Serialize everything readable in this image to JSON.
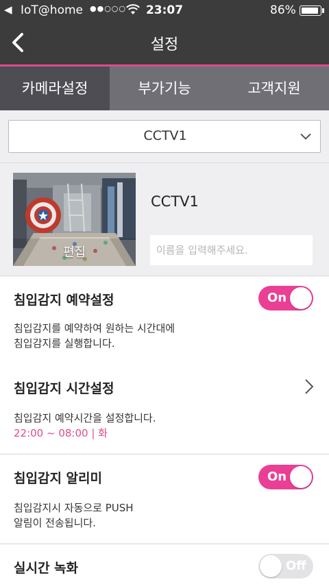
{
  "status_bar": {
    "back_app": "◀",
    "carrier": "IoT@home",
    "signal": "●●○○○",
    "time": "23:07",
    "battery_percent": "86%",
    "battery_level": 0.86
  },
  "header": {
    "title": "설정",
    "back_icon": "chevron-left-icon"
  },
  "tabs": [
    {
      "label": "카메라설정",
      "active": true
    },
    {
      "label": "부가기능",
      "active": false
    },
    {
      "label": "고객지원",
      "active": false
    }
  ],
  "camera_select": {
    "selected": "CCTV1"
  },
  "camera": {
    "thumbnail_overlay": "편집",
    "name": "CCTV1",
    "name_input_placeholder": "이름을 입력해주세요."
  },
  "settings": {
    "intrusion_schedule": {
      "title": "침입감지 예약설정",
      "desc_line1": "침입감지를 예약하여 원하는 시간대에",
      "desc_line2": "침입감지를 실행합니다.",
      "toggle_label": "On",
      "enabled": true
    },
    "intrusion_time": {
      "title": "침입감지 시간설정",
      "desc": "침입감지 예약시간을 설정합니다.",
      "schedule": "22:00 ~ 08:00 | 화"
    },
    "intrusion_alarm": {
      "title": "침입감지 알리미",
      "desc_line1": "침입감지시 자동으로 PUSH",
      "desc_line2": "알림이 전송됩니다.",
      "toggle_label": "On",
      "enabled": true
    },
    "realtime_recording": {
      "title": "실시간 녹화",
      "toggle_label": "Off",
      "enabled": false
    }
  },
  "colors": {
    "accent": "#ea3f95",
    "header_bg": "#3c3c3c",
    "tab_bg": "#6f6f75",
    "tab_active_bg": "#4d4d53"
  }
}
